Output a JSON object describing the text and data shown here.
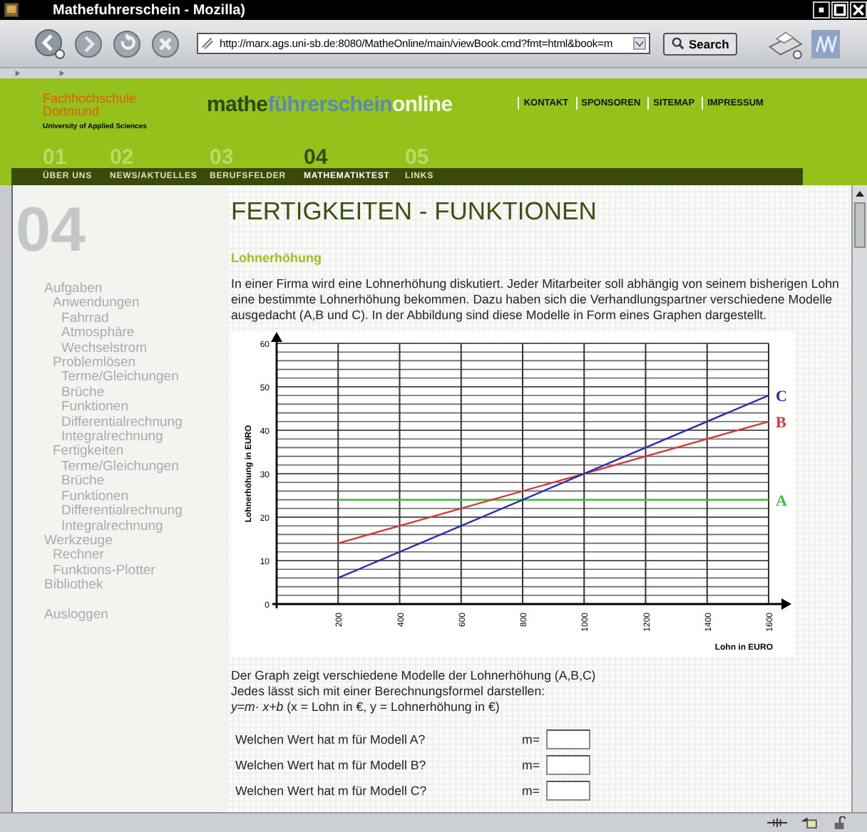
{
  "window": {
    "title": "Mathefuhrerschein - Mozilla)"
  },
  "browser": {
    "url": "http://marx.ags.uni-sb.de:8080/MatheOnline/main/viewBook.cmd?fmt=html&book=m",
    "search_button": "Search"
  },
  "header": {
    "school": "Fachhochschule Dortmund",
    "school_sub": "University of Applied Sciences",
    "site_logo": [
      {
        "text": "mathe",
        "color": "#2e4a12"
      },
      {
        "text": "führerschein",
        "color": "#5a88b4"
      },
      {
        "text": "online",
        "color": "#f2f6e6"
      }
    ],
    "links": [
      "KONTAKT",
      "SPONSOREN",
      "SITEMAP",
      "IMPRESSUM"
    ],
    "nav": [
      {
        "number": "01",
        "label": "ÜBER UNS",
        "selected": false
      },
      {
        "number": "02",
        "label": "NEWS/AKTUELLES",
        "selected": false
      },
      {
        "number": "03",
        "label": "BERUFSFELDER",
        "selected": false
      },
      {
        "number": "04",
        "label": "MATHEMATIKTEST",
        "selected": true
      },
      {
        "number": "05",
        "label": "LINKS",
        "selected": false
      }
    ]
  },
  "sidebar": {
    "section_number": "04",
    "items": [
      {
        "label": "Aufgaben",
        "children": [
          {
            "label": "Anwendungen",
            "children": [
              {
                "label": "Fahrrad"
              },
              {
                "label": "Atmosphäre"
              },
              {
                "label": "Wechselstrom"
              }
            ]
          },
          {
            "label": "Problemlösen",
            "children": [
              {
                "label": "Terme/Gleichungen"
              },
              {
                "label": "Brüche"
              },
              {
                "label": "Funktionen"
              },
              {
                "label": "Differentialrechnung"
              },
              {
                "label": "Integralrechnung"
              }
            ]
          },
          {
            "label": "Fertigkeiten",
            "children": [
              {
                "label": "Terme/Gleichungen"
              },
              {
                "label": "Brüche"
              },
              {
                "label": "Funktionen"
              },
              {
                "label": "Differentialrechnung"
              },
              {
                "label": "Integralrechnung"
              }
            ]
          }
        ]
      },
      {
        "label": "Werkzeuge",
        "children": [
          {
            "label": "Rechner"
          },
          {
            "label": "Funktions-Plotter"
          }
        ]
      },
      {
        "label": "Bibliothek"
      },
      {
        "label": "Ausloggen",
        "separated": true
      }
    ]
  },
  "content": {
    "title": "FERTIGKEITEN - FUNKTIONEN",
    "subtitle": "Lohnerhöhung",
    "intro": "In einer Firma wird eine Lohnerhöhung diskutiert. Jeder Mitarbeiter soll abhängig von seinem bisherigen Lohn eine bestimmte Lohnerhöhung bekommen. Dazu haben sich die Verhandlungspartner verschiedene Modelle ausgedacht (A,B und C). In der Abbildung sind diese Modelle in Form eines Graphen dargestellt.",
    "chart_data": {
      "type": "line",
      "xlabel": "Lohn in EURO",
      "ylabel": "Lohnerhöhung in EURO",
      "x": [
        200,
        1600
      ],
      "xlim": [
        0,
        1600
      ],
      "grid": true,
      "ylim": [
        0,
        60
      ],
      "xticks": [
        200,
        400,
        600,
        800,
        1000,
        1200,
        1400,
        1600
      ],
      "yticks": [
        0,
        10,
        20,
        30,
        40,
        50,
        60
      ],
      "series": [
        {
          "name": "A",
          "color": "#33c43a",
          "values": [
            24,
            24
          ]
        },
        {
          "name": "B",
          "color": "#d03a3a",
          "values": [
            14,
            42
          ]
        },
        {
          "name": "C",
          "color": "#2a2ab0",
          "values": [
            6,
            48
          ]
        }
      ]
    },
    "explanation": [
      "Der Graph zeigt verschiedene Modelle der Lohnerhöhung (A,B,C)",
      "Jedes lässt sich mit einer Berechnungsformel darstellen:",
      "*y=m· x+b* (x = Lohn in €, y = Lohnerhöhung in €)"
    ],
    "questions": [
      {
        "text": "Welchen Wert hat m für Modell A?",
        "field_label": "m="
      },
      {
        "text": "Welchen Wert hat m für Modell B?",
        "field_label": "m="
      },
      {
        "text": "Welchen Wert hat m für Modell C?",
        "field_label": "m="
      }
    ]
  }
}
